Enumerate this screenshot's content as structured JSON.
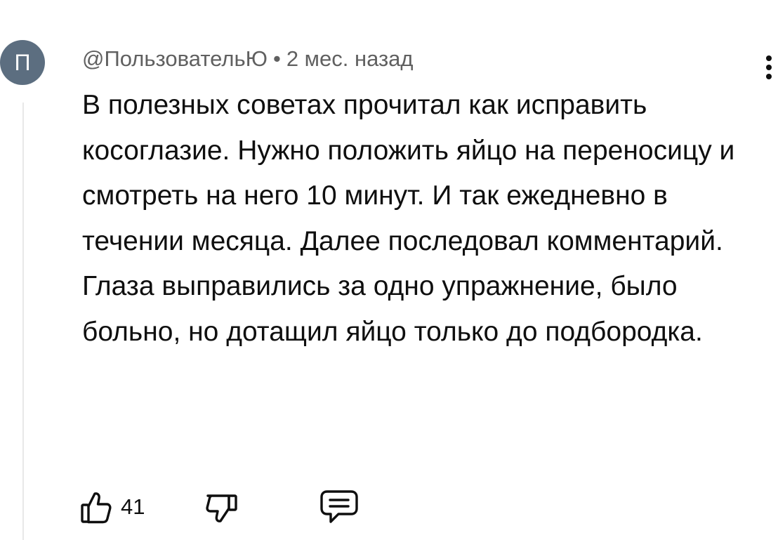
{
  "comment": {
    "avatar_letter": "П",
    "author": "@ПользовательЮ",
    "separator": "•",
    "time": "2 мес. назад",
    "text": "В полезных советах прочитал как исправить косоглазие. Нужно положить яйцо на переносицу и смотреть на него 10 минут. И так ежедневно в течении месяца. Далее последовал комментарий. Глаза выправились за одно упражнение, было больно, но дотащил яйцо только до подбородка.",
    "like_count": "41"
  },
  "icons": {
    "menu": "more-vertical-icon",
    "like": "thumbs-up-icon",
    "dislike": "thumbs-down-icon",
    "reply": "comment-reply-icon"
  },
  "colors": {
    "avatar_bg": "#5c6e80",
    "text": "#0f0f0f",
    "meta": "#606060",
    "thread_line": "#e8e8e8"
  }
}
